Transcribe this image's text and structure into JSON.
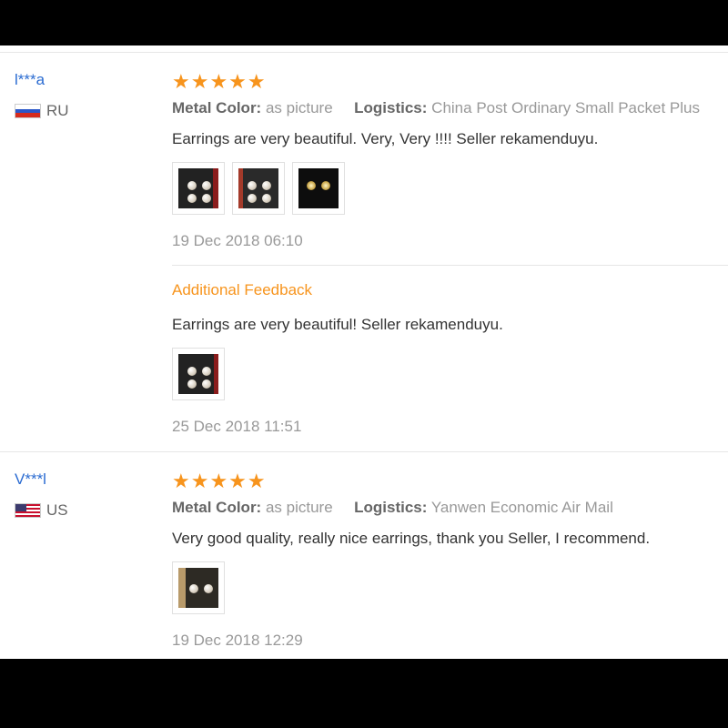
{
  "labels": {
    "metal_color": "Metal Color:",
    "logistics": "Logistics:"
  },
  "reviews": [
    {
      "user": "l***a",
      "country": "RU",
      "stars": "★★★★★",
      "metal_color": "as picture",
      "logistics": "China Post Ordinary Small Packet Plus",
      "text": "Earrings are very beautiful. Very, Very !!!! Seller rekamenduyu.",
      "date": "19 Dec 2018 06:10",
      "additional": {
        "title": "Additional Feedback",
        "text": "Earrings are very beautiful! Seller rekamenduyu.",
        "date": "25 Dec 2018 11:51"
      }
    },
    {
      "user": "V***l",
      "country": "US",
      "stars": "★★★★★",
      "metal_color": "as picture",
      "logistics": "Yanwen Economic Air Mail",
      "text": "Very good quality, really nice earrings, thank you Seller, I recommend.",
      "date": "19 Dec 2018 12:29"
    }
  ]
}
